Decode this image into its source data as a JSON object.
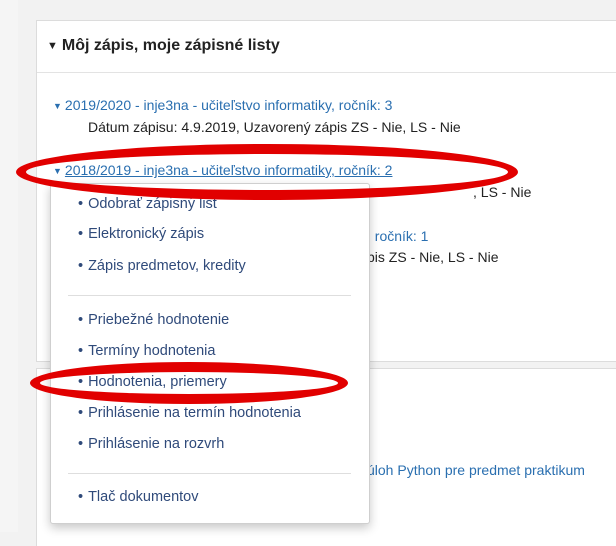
{
  "section": {
    "title": "Môj zápis, moje zápisné listy"
  },
  "entries": [
    {
      "label": "2019/2020 - inje3na - učiteľstvo informatiky, ročník: 3",
      "detail": "Dátum zápisu: 4.9.2019, Uzavorený zápis ZS - Nie, LS - Nie"
    },
    {
      "label": "2018/2019 - inje3na - učiteľstvo informatiky, ročník: 2",
      "detail_visible": ", LS - Nie"
    },
    {
      "label_visible": ", ročník: 1",
      "detail_visible": "pis ZS - Nie, LS - Nie"
    }
  ],
  "dropdown": {
    "items_group1": [
      "Odobrať zápisný list",
      "Elektronický zápis",
      "Zápis predmetov, kredity"
    ],
    "items_group2": [
      "Priebežné hodnotenie",
      "Termíny hodnotenia",
      "Hodnotenia, priemery",
      "Prihlásenie na termín hodnotenia",
      "Prihlásenie na rozvrh"
    ],
    "items_group3": [
      "Tlač dokumentov"
    ]
  },
  "background_snippet": "úloh Python pre predmet praktikum",
  "colors": {
    "link": "#2a6fb0",
    "menu_text": "#2f4a7a",
    "highlight_ellipse": "#e10000"
  }
}
